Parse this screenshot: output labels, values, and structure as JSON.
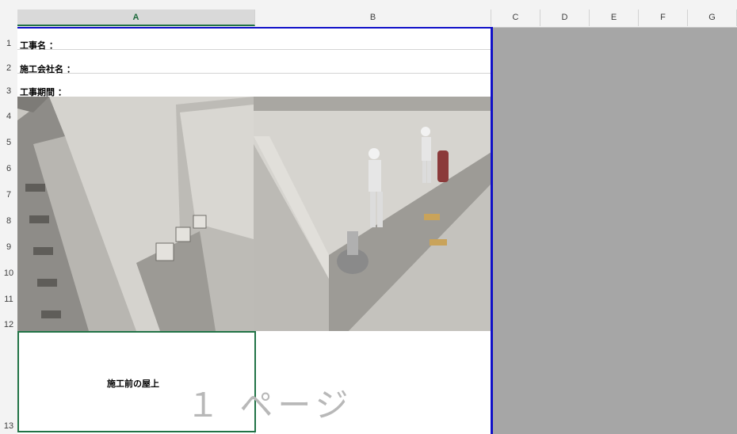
{
  "columns": [
    "A",
    "B",
    "C",
    "D",
    "E",
    "F",
    "G"
  ],
  "rows": [
    "1",
    "2",
    "3",
    "4",
    "5",
    "6",
    "7",
    "8",
    "9",
    "10",
    "11",
    "12",
    "13"
  ],
  "cells": {
    "a1": "工事名 ：",
    "a2": "施工会社名 ：",
    "a3": "工事期間 ："
  },
  "photos": {
    "left": "rooftop-concrete-photo",
    "right": "rooftop-workers-grinding-photo"
  },
  "caption": "施工前の屋上",
  "page_watermark": "１ ページ",
  "colors": {
    "page_break": "#1010c8",
    "selection": "#217346",
    "outside_area": "#a6a6a6"
  }
}
